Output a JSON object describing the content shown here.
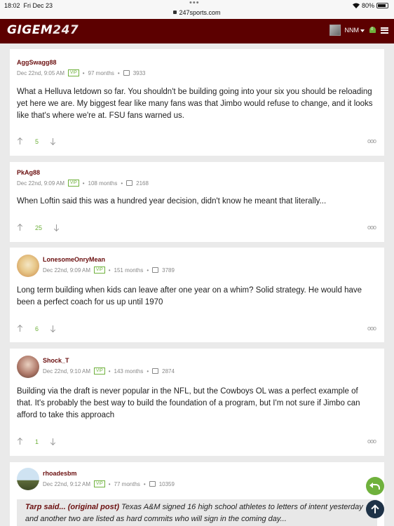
{
  "status": {
    "time": "18:02",
    "date": "Fri Dec 23",
    "url": "247sports.com",
    "battery": "80%"
  },
  "header": {
    "logo_a": "GIGEM",
    "logo_b": "247",
    "user": "NNM",
    "notifications": "0"
  },
  "posts": [
    {
      "user": "AggSwagg88",
      "date": "Dec 22nd, 9:05 AM",
      "vip": "VIP",
      "months": "97 months",
      "count": "3933",
      "body": "What a Helluva letdown so far. You shouldn't be building going into your six you should be reloading yet here we are. My biggest fear like many fans was that Jimbo would refuse to change, and it looks like that's where we're at. FSU fans warned us.",
      "votes": "5"
    },
    {
      "user": "PkAg88",
      "date": "Dec 22nd, 9:09 AM",
      "vip": "VIP",
      "months": "108 months",
      "count": "2168",
      "body": "When Loftin said this was a hundred year decision, didn't know he meant that literally...",
      "votes": "25"
    },
    {
      "user": "LonesomeOnryMean",
      "date": "Dec 22nd, 9:09 AM",
      "vip": "VIP",
      "months": "151 months",
      "count": "3789",
      "body": "Long term building when kids can leave after one year on a whim? Solid strategy. He would have been a perfect coach for us up until 1970",
      "votes": "6"
    },
    {
      "user": "Shock_T",
      "date": "Dec 22nd, 9:10 AM",
      "vip": "VIP",
      "months": "143 months",
      "count": "2874",
      "body": "Building via the draft is never popular in the NFL, but the Cowboys OL was a perfect example of that. It's probably the best way to build the foundation of a program, but I'm not sure if Jimbo can afford to take this approach",
      "votes": "1"
    },
    {
      "user": "rhoadesbm",
      "date": "Dec 22nd, 9:12 AM",
      "vip": "VIP",
      "months": "77 months",
      "count": "10359",
      "quote_author": "Tarp said... (original post)",
      "quote": "Texas A&M signed 16 high school athletes to letters of intent yesterday and another two are listed as hard commits who will sign in the coming day..."
    }
  ],
  "more_label": "ooo"
}
